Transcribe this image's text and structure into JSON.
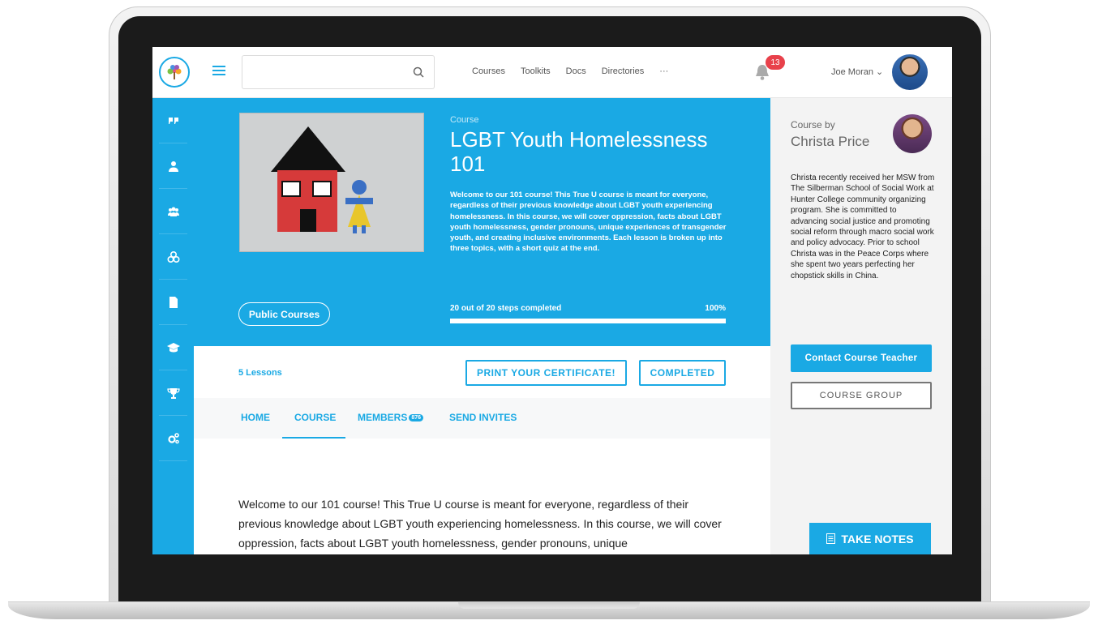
{
  "search": {
    "placeholder": ""
  },
  "nav": {
    "items": [
      "Courses",
      "Toolkits",
      "Docs",
      "Directories"
    ],
    "more": "···"
  },
  "notifications": {
    "count": "13"
  },
  "user": {
    "name": "Joe Moran ⌄"
  },
  "sidebar": {
    "icons": [
      "quote-icon",
      "user-icon",
      "users-icon",
      "groups-icon",
      "document-icon",
      "graduation-cap-icon",
      "trophy-icon",
      "gears-icon"
    ]
  },
  "course": {
    "label": "Course",
    "title": "LGBT Youth Homelessness 101",
    "description": "Welcome to our 101 course! This True U course is meant for everyone, regardless of their previous knowledge about LGBT youth experiencing homelessness. In this course, we will cover oppression, facts about LGBT youth homelessness, gender pronouns, unique experiences of transgender youth, and creating inclusive environments. Each lesson is broken up into three topics, with a short quiz at the end.",
    "category_button": "Public Courses",
    "progress_text": "20 out of 20 steps completed",
    "progress_pct": "100%",
    "progress_value": 1.0,
    "lessons": "5 Lessons",
    "print_button": "PRINT YOUR CERTIFICATE!",
    "completed_button": "COMPLETED"
  },
  "tabs": {
    "home": "HOME",
    "course": "COURSE",
    "members": "MEMBERS",
    "members_count": "876",
    "invites": "SEND INVITES",
    "active": "COURSE"
  },
  "content": {
    "text": "Welcome to our 101 course! This True U course is meant for everyone, regardless of their previous knowledge about LGBT youth experiencing homelessness. In this course, we will cover oppression, facts about LGBT youth homelessness, gender pronouns, unique"
  },
  "teacher": {
    "by_label": "Course by",
    "name": "Christa Price",
    "bio": "Christa recently received her MSW from The Silberman School of Social Work at Hunter College community organizing program. She is committed to advancing social justice and promoting social reform through macro social work and policy advocacy. Prior to school Christa was in the Peace Corps where she spent two years perfecting her chopstick skills in China.",
    "contact_button": "Contact Course Teacher",
    "group_button": "COURSE GROUP"
  },
  "notes": {
    "label": "TAKE NOTES"
  },
  "colors": {
    "accent": "#1aa9e4",
    "badge": "#e8414b",
    "panel": "#f3f3f3"
  }
}
